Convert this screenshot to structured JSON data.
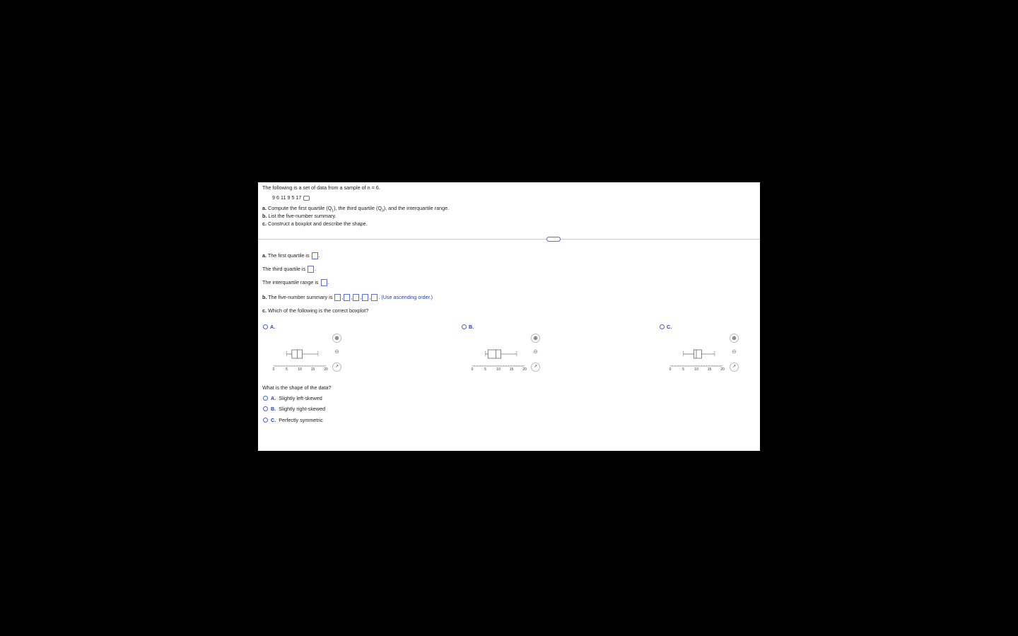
{
  "question": {
    "intro": "The following is a set of data from a sample of n = 6.",
    "data_values": "9   6   11   9   5   17",
    "parts": [
      {
        "letter": "a.",
        "text": "Compute the first quartile (Q",
        "sub": "1",
        "text2": "), the third quartile (Q",
        "sub2": "3",
        "text3": "), and the interquartile range."
      },
      {
        "letter": "b.",
        "text": "List the five-number summary."
      },
      {
        "letter": "c.",
        "text": "Construct a boxplot and describe the shape."
      }
    ]
  },
  "answers": {
    "q1_prefix": "a.",
    "q1_label": "The first quartile is",
    "q3_label": "The third quartile is",
    "iqr_label": "The interquartile range is",
    "five_prefix": "b.",
    "five_label": "The five-number summary is",
    "five_hint": "(Use ascending order.)",
    "boxplot_prefix": "c.",
    "boxplot_question": "Which of the following is the correct boxplot?"
  },
  "boxplot_options": [
    {
      "letter": "A.",
      "min": 5,
      "q1": 7,
      "median": 9,
      "q3": 11,
      "max": 17
    },
    {
      "letter": "B.",
      "min": 5,
      "q1": 6,
      "median": 9,
      "q3": 11,
      "max": 17
    },
    {
      "letter": "C.",
      "min": 5,
      "q1": 9,
      "median": 10,
      "q3": 12,
      "max": 17
    }
  ],
  "axis_ticks": [
    "0",
    "5",
    "10",
    "15",
    "20"
  ],
  "axis_range": [
    0,
    20
  ],
  "shape": {
    "question": "What is the shape of the data?",
    "options": [
      {
        "letter": "A.",
        "text": "Slightly left-skewed"
      },
      {
        "letter": "B.",
        "text": "Slightly right-skewed"
      },
      {
        "letter": "C.",
        "text": "Perfectly symmetric"
      }
    ]
  },
  "icons": {
    "zoom_in": "zoom-in-icon",
    "zoom_out": "zoom-out-icon",
    "popout": "popout-icon",
    "data_copy": "data-copy-icon"
  },
  "colors": {
    "accent": "#2d3fa0",
    "input_border": "#5b6dd6"
  }
}
